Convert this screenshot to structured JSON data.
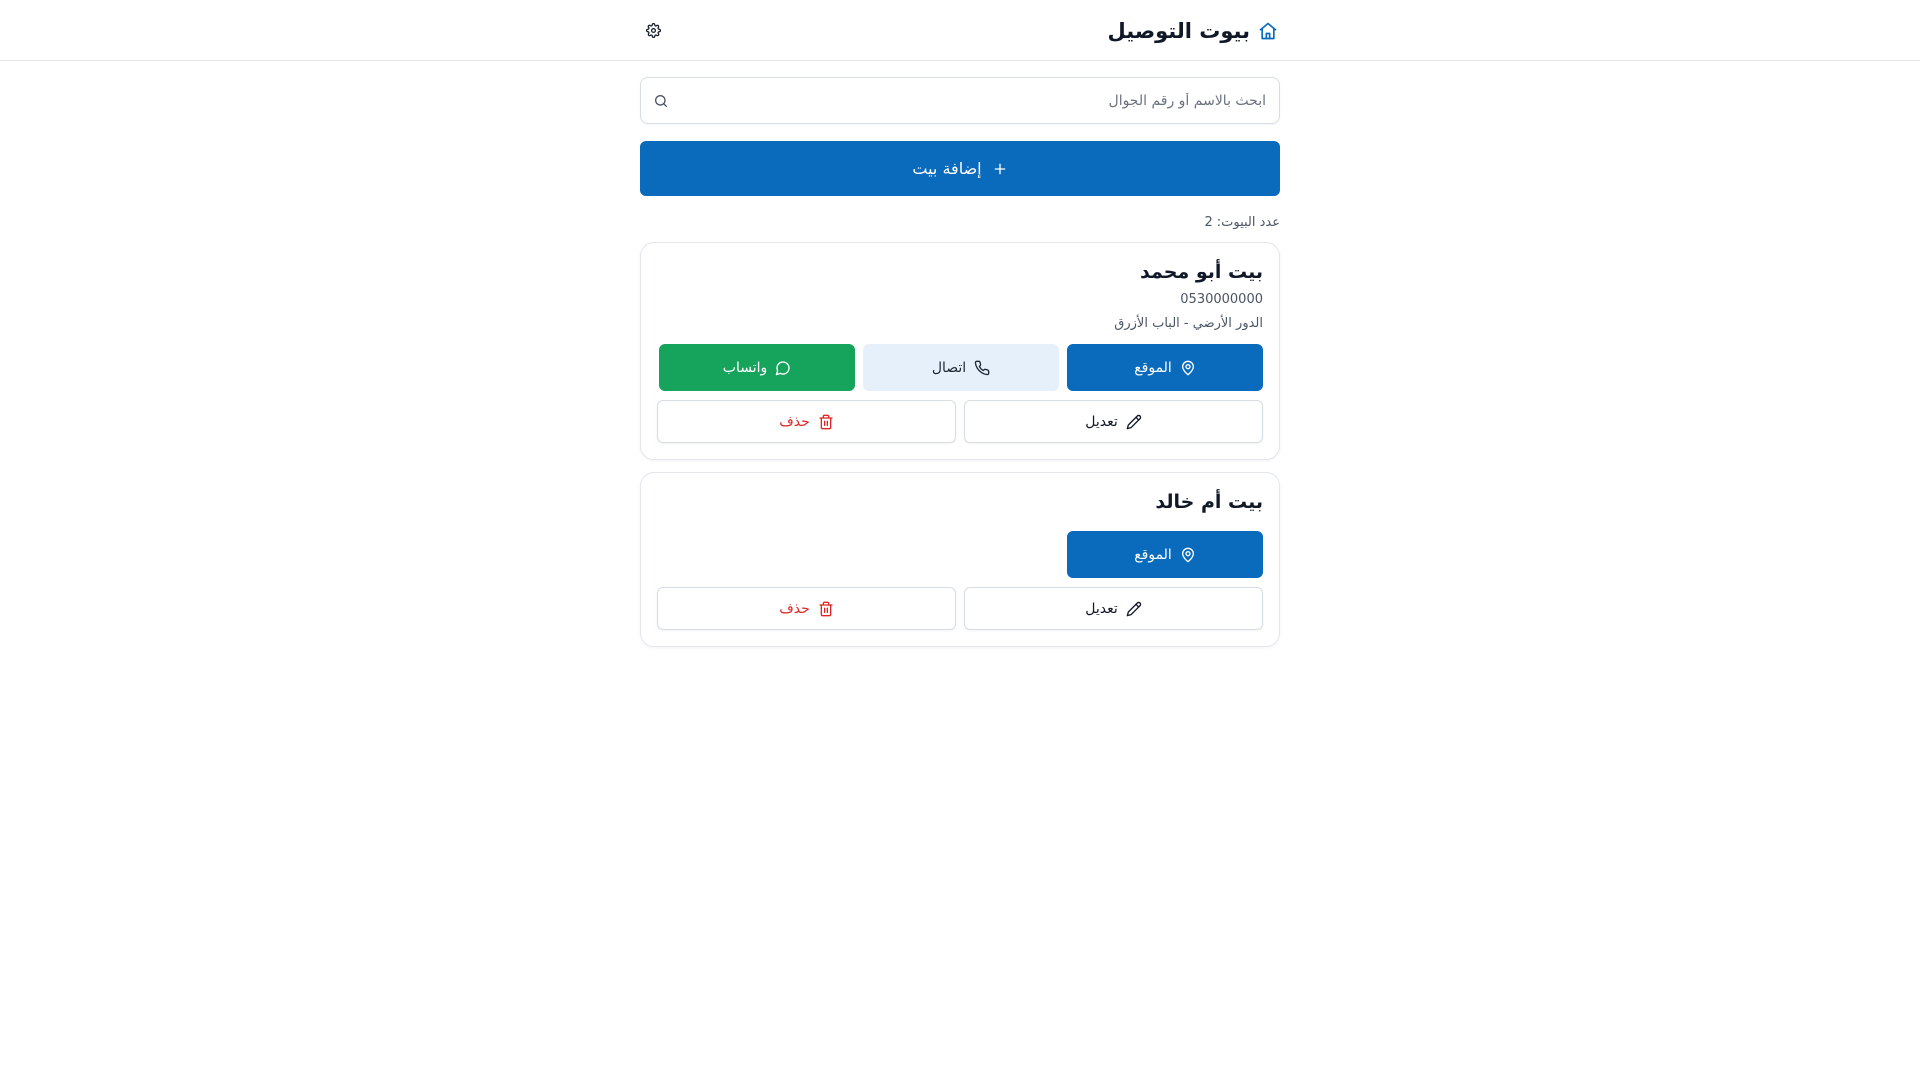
{
  "header": {
    "title": "بيوت التوصيل",
    "home_icon": "home-icon",
    "settings_icon": "gear-icon"
  },
  "search": {
    "placeholder": "ابحث بالاسم أو رقم الجوال",
    "value": ""
  },
  "toolbar": {
    "add_label": "إضافة بيت"
  },
  "summary": {
    "count_label": "عدد البيوت:",
    "count_value": "2"
  },
  "houses": [
    {
      "name": "بيت أبو محمد",
      "phone": "0530000000",
      "note": "الدور الأرضي - الباب الأزرق",
      "location_label": "الموقع",
      "call_label": "اتصال",
      "whatsapp_label": "واتساب",
      "edit_label": "تعديل",
      "delete_label": "حذف"
    },
    {
      "name": "بيت أم خالد",
      "location_label": "الموقع",
      "edit_label": "تعديل",
      "delete_label": "حذف"
    }
  ],
  "colors": {
    "primary": "#0a6bbd",
    "whatsapp": "#16a35c",
    "call_bg": "#e6f0fb",
    "danger": "#dc2626"
  }
}
